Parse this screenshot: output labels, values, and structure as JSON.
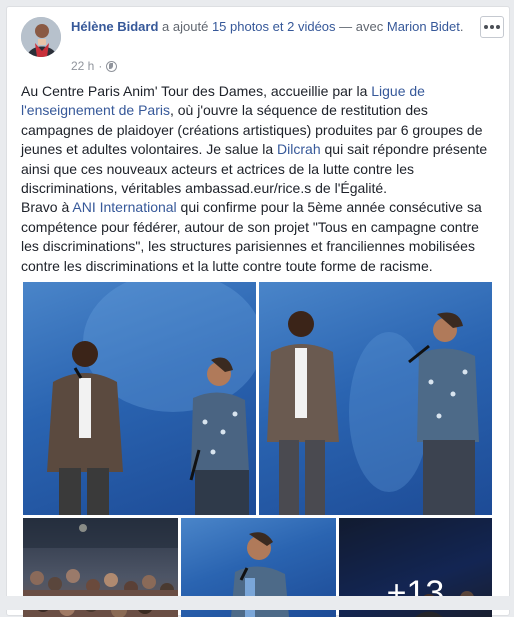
{
  "post": {
    "author": "Hélène Bidard",
    "action_text": "a ajouté",
    "media_link": "15 photos et 2 vidéos",
    "with_text": "— avec",
    "tagged": "Marion Bidet",
    "tagged_suffix": ".",
    "timestamp": "22 h",
    "separator": "·",
    "privacy_icon": "globe-icon",
    "more_icon": "more-options-icon",
    "body": {
      "p1_a": "Au Centre Paris Anim' Tour des Dames, accueillie par la ",
      "p1_link": "Ligue de l'enseignement de Paris",
      "p1_b": ", où j'ouvre la séquence de restitution des campagnes de plaidoyer (créations artistiques) produites par 6 groupes de jeunes et adultes volontaires. Je salue la ",
      "p1_link2": "Dilcrah",
      "p1_c": " qui sait répondre présente ainsi que ces nouveaux acteurs et actrices de la lutte contre les discriminations, véritables ambassad.eur/rice.s de l'Égalité.",
      "p2_a": "Bravo à ",
      "p2_link": "ANI International",
      "p2_b": " qui confirme pour la 5ème année consécutive sa compétence pour fédérer, autour de son projet \"Tous en campagne contre les discriminations\", les structures parisiennes et franciliennes mobilisées contre les discriminations et la lutte contre toute forme de racisme."
    },
    "more_photos_count": "+13"
  },
  "colors": {
    "link": "#365899",
    "text": "#1d2129",
    "meta": "#90949c",
    "stage_blue": "#2a64b1"
  }
}
